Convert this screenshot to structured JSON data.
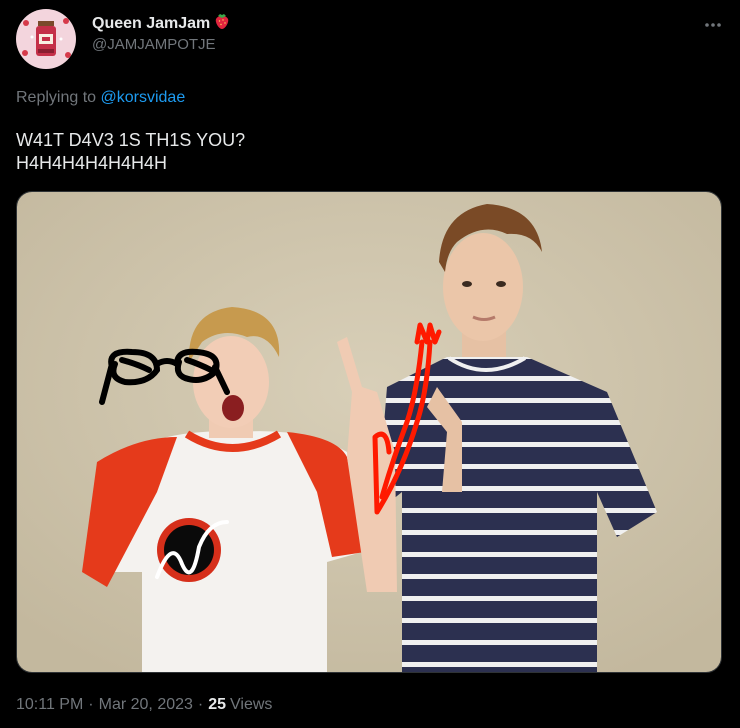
{
  "tweet": {
    "author": {
      "name": "Queen JamJam",
      "emoji": "🍓",
      "handle": "@JAMJAMPOTJE",
      "avatar_icon": "jam-jar-avatar"
    },
    "more_icon": "ellipsis-icon",
    "reply": {
      "prefix": "Replying to ",
      "mention": "@korsvidae"
    },
    "text_lines": [
      "W41T D4V3 1S TH1S YOU?",
      "H4H4H4H4H4H4H"
    ],
    "media": {
      "description_icon": "photo-of-two-people",
      "accent_colors": {
        "background": "#cfc5ad",
        "red_shirt": "#e53a1b",
        "striped_shirt": "#2c3050",
        "drawing_black": "#000000",
        "drawing_red": "#ff1a00"
      }
    },
    "meta": {
      "time": "10:11 PM",
      "date": "Mar 20, 2023",
      "separator": "·",
      "views_count": "25",
      "views_label": "Views"
    }
  },
  "colors": {
    "background": "#000000",
    "text_primary": "#e7e9ea",
    "text_secondary": "#71767b",
    "link": "#1d9bf0"
  }
}
